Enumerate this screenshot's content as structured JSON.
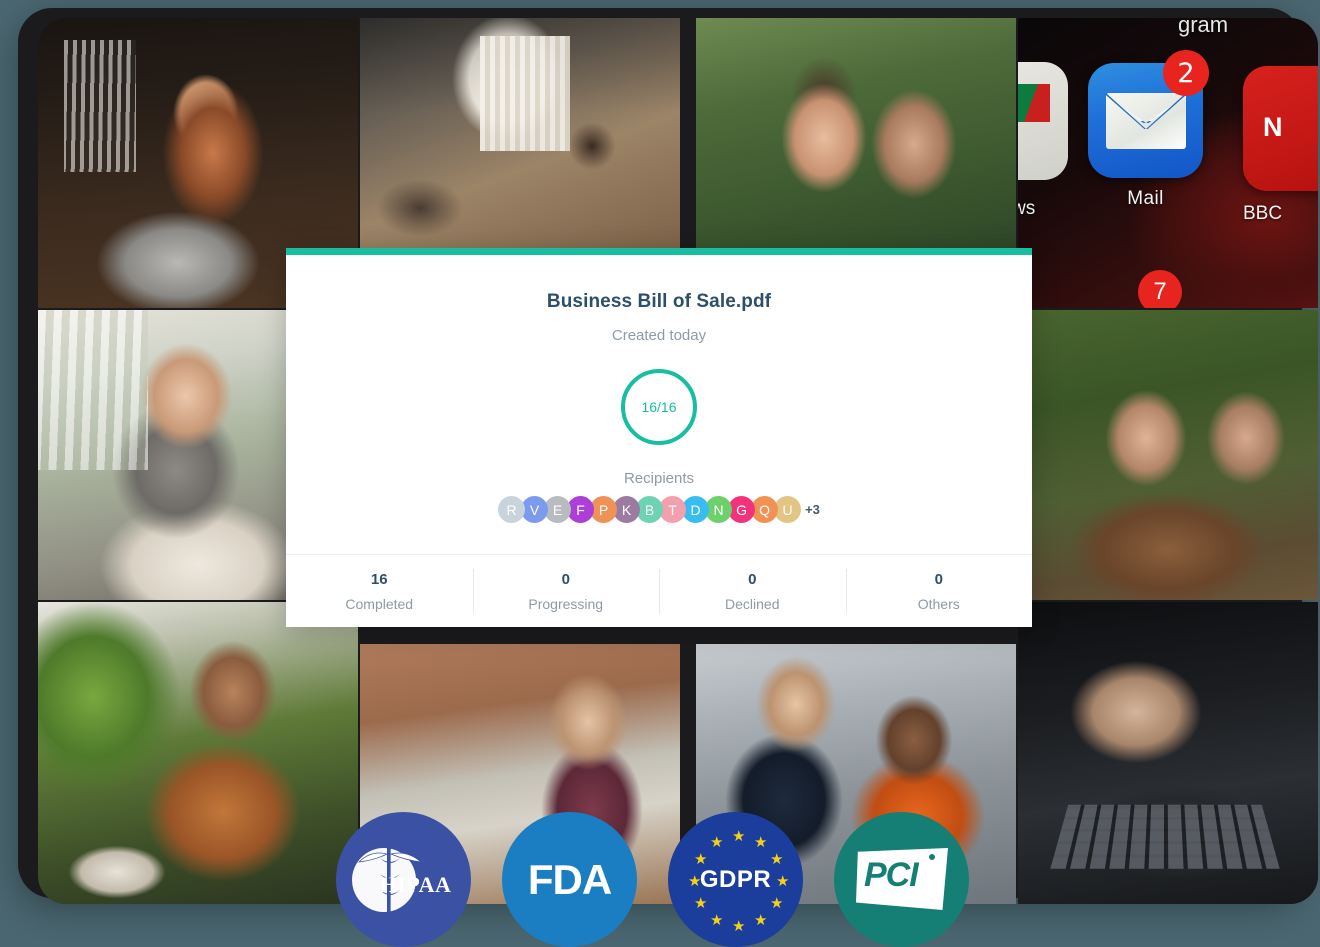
{
  "theme": {
    "page_background": "#4a6670",
    "device_frame": "#1b1b1d",
    "accent_teal": "#17bfa0",
    "title_navy": "#2e4f68",
    "muted_grey": "#8d9ba6"
  },
  "card": {
    "accent_color": "#17bfa0",
    "title": "Business Bill of Sale.pdf",
    "subtitle": "Created today",
    "progress": {
      "label": "16/16",
      "completed": 16,
      "total": 16,
      "percent": 100,
      "ring_color": "#17bfa0"
    },
    "recipients": {
      "label": "Recipients",
      "overflow_label": "+3",
      "avatars": [
        {
          "initial": "R",
          "color": "#c9d3db"
        },
        {
          "initial": "V",
          "color": "#7c9bee"
        },
        {
          "initial": "E",
          "color": "#b8bcc0"
        },
        {
          "initial": "F",
          "color": "#ab3fd6"
        },
        {
          "initial": "P",
          "color": "#ee9257"
        },
        {
          "initial": "K",
          "color": "#9b7ba0"
        },
        {
          "initial": "B",
          "color": "#6ed3b0"
        },
        {
          "initial": "T",
          "color": "#f2a0ae"
        },
        {
          "initial": "D",
          "color": "#39bdf0"
        },
        {
          "initial": "N",
          "color": "#6ed06a"
        },
        {
          "initial": "G",
          "color": "#f2337c"
        },
        {
          "initial": "Q",
          "color": "#f09254"
        },
        {
          "initial": "U",
          "color": "#e2c583"
        }
      ]
    },
    "stats": [
      {
        "value": "16",
        "label": "Completed"
      },
      {
        "value": "0",
        "label": "Progressing"
      },
      {
        "value": "0",
        "label": "Declined"
      },
      {
        "value": "0",
        "label": "Others"
      }
    ]
  },
  "compliance_badges": [
    {
      "key": "hipaa",
      "label": "HIPAA",
      "color": "#3b52a4"
    },
    {
      "key": "fda",
      "label": "FDA",
      "color": "#1b7ec2"
    },
    {
      "key": "gdpr",
      "label": "GDPR",
      "color": "#1b3d9c"
    },
    {
      "key": "pci",
      "label": "PCI",
      "color": "#157f76"
    }
  ],
  "phone_screen": {
    "mail_app_label": "Mail",
    "mail_badge_count": "2",
    "bbc_label": "BBC",
    "bbc_tile_letter": "N",
    "news_label": "ws",
    "gram_label": "gram",
    "small_badge_count": "7"
  },
  "photos": [
    {
      "id": "p1",
      "alt": "woman with curly hair drinking coffee at laptop in cafe"
    },
    {
      "id": "p2",
      "alt": "team with laptops around conference room table"
    },
    {
      "id": "p3",
      "alt": "couple outdoors smiling, woman on phone"
    },
    {
      "id": "p4",
      "alt": "smartphone home screen showing Mail app icon with badge"
    },
    {
      "id": "p5",
      "alt": "woman sitting on bed reading by window"
    },
    {
      "id": "p6",
      "alt": "man and woman at outdoor cafe with laptop"
    },
    {
      "id": "p7",
      "alt": "bearded man giving thumbs up at laptop near plants"
    },
    {
      "id": "p8",
      "alt": "woman working on laptop against brick wall"
    },
    {
      "id": "p9",
      "alt": "two men shaking hands in office"
    },
    {
      "id": "p10",
      "alt": "hands typing on laptop keyboard in low light"
    }
  ]
}
